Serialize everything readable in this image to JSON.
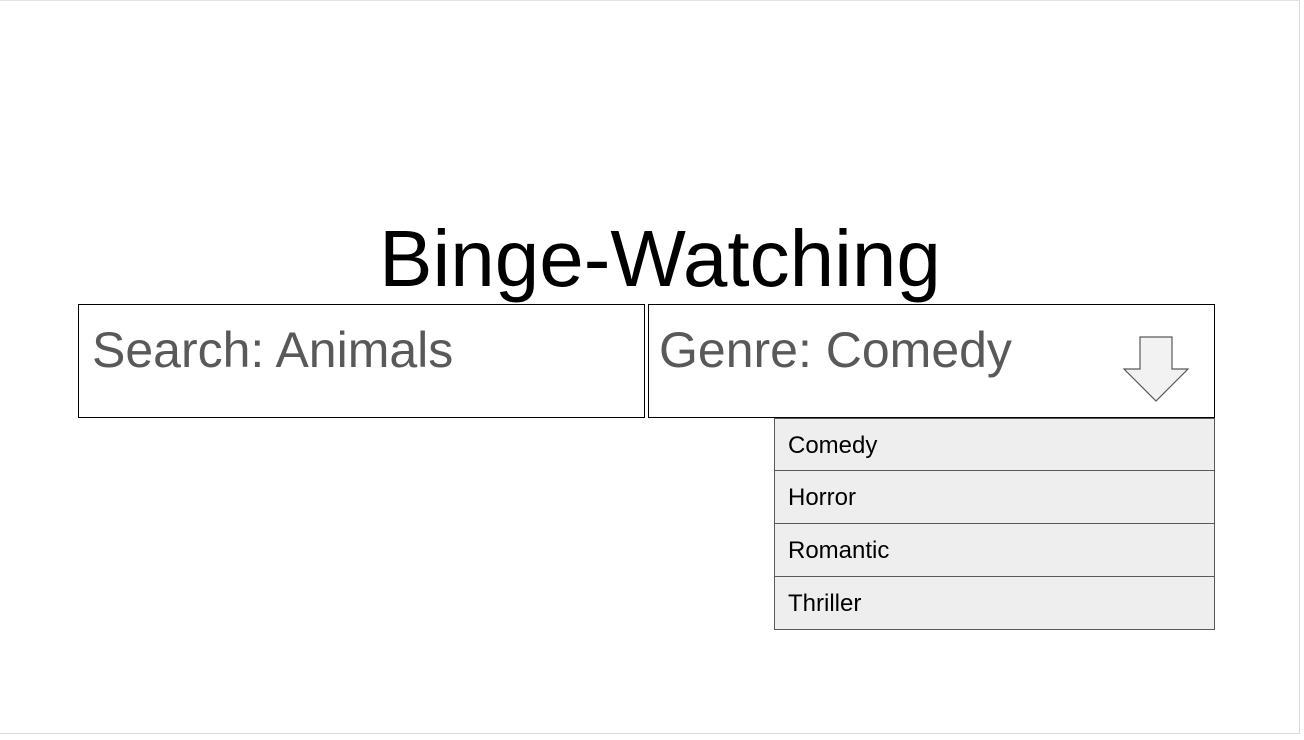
{
  "title": "Binge-Watching",
  "search": {
    "label": "Search: Animals"
  },
  "genre": {
    "label": "Genre: Comedy",
    "toggle_icon": "arrow-down-icon",
    "options": [
      "Comedy",
      "Horror",
      "Romantic",
      "Thriller"
    ]
  },
  "colors": {
    "field_text": "#595959",
    "option_background": "#eeeeee",
    "border": "#000000"
  }
}
